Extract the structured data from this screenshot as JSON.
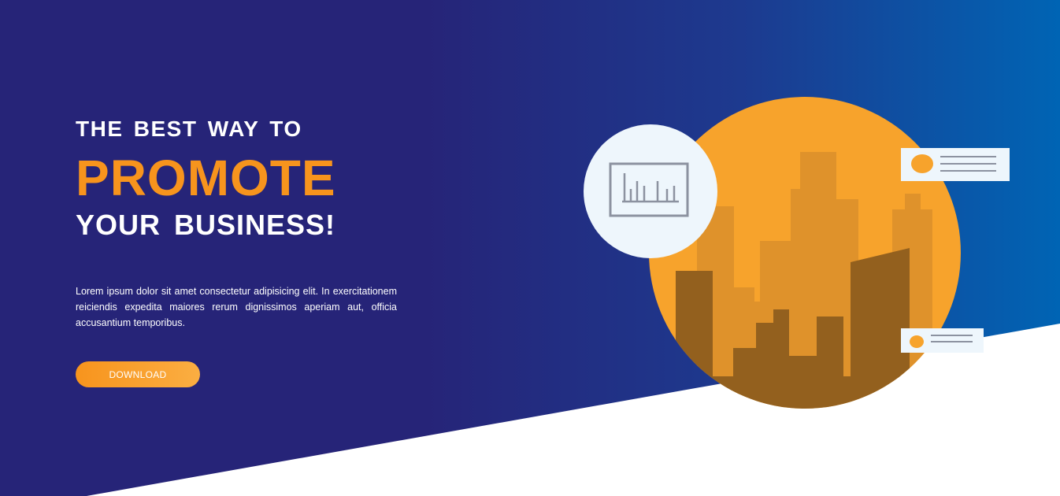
{
  "hero": {
    "headline_line1": "THE BEST WAY TO",
    "headline_line2": "PROMOTE",
    "headline_line3": "YOUR BUSINESS!",
    "body": "Lorem ipsum dolor sit amet consectetur adipisicing elit. In exercitationem reiciendis expedita maiores rerum dignissimos aperiam aut, officia accusantium temporibus.",
    "download_label": "DOWNLOAD"
  },
  "colors": {
    "background_left": "#262478",
    "background_right": "#0064b4",
    "accent_orange": "#f7941d",
    "circle_orange": "#f7a32c",
    "building_mid": "#df922b",
    "building_dark": "#93601e",
    "icon_circle": "#eef6fc",
    "icon_gray": "#8c92a0"
  },
  "illustration": {
    "icons": [
      "city-skyline",
      "bar-chart-icon",
      "info-card-icon"
    ]
  }
}
